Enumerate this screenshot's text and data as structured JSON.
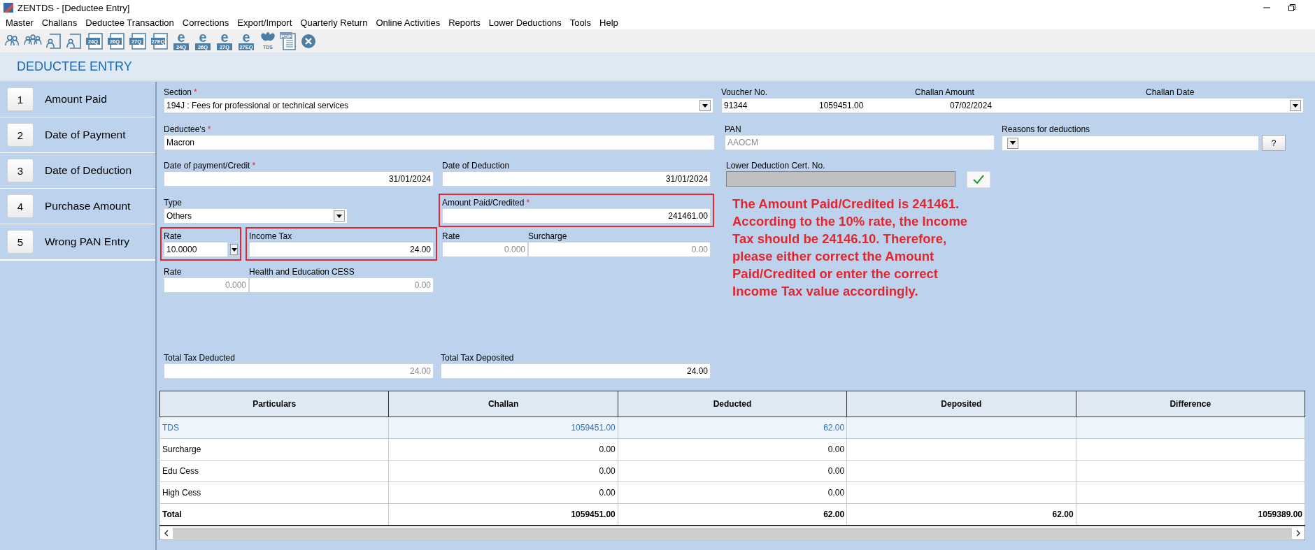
{
  "window": {
    "title": "ZENTDS - [Deductee Entry]"
  },
  "menu": [
    "Master",
    "Challans",
    "Deductee Transaction",
    "Corrections",
    "Export/Import",
    "Quarterly Return",
    "Online Activities",
    "Reports",
    "Lower Deductions",
    "Tools",
    "Help"
  ],
  "toolbar": [
    {
      "kind": "person"
    },
    {
      "kind": "group"
    },
    {
      "kind": "contact-doc"
    },
    {
      "kind": "contact-doc"
    },
    {
      "kind": "form-doc",
      "label": "24Q"
    },
    {
      "kind": "form-doc",
      "label": "26Q"
    },
    {
      "kind": "form-doc",
      "label": "27Q"
    },
    {
      "kind": "form-doc",
      "label": "27EQ"
    },
    {
      "kind": "e-form",
      "glyph": "e",
      "label": "24Q"
    },
    {
      "kind": "e-form",
      "glyph": "e",
      "label": "26Q"
    },
    {
      "kind": "e-form",
      "glyph": "e",
      "label": "27Q"
    },
    {
      "kind": "e-form",
      "glyph": "e",
      "label": "27EQ"
    },
    {
      "kind": "logo",
      "label": "TDS"
    },
    {
      "kind": "pdf",
      "label": "PDF"
    },
    {
      "kind": "close"
    }
  ],
  "header": {
    "title": "DEDUCTEE ENTRY"
  },
  "sidebar": {
    "items": [
      {
        "number": "1",
        "label": "Amount Paid"
      },
      {
        "number": "2",
        "label": "Date of Payment"
      },
      {
        "number": "3",
        "label": "Date of Deduction"
      },
      {
        "number": "4",
        "label": "Purchase Amount"
      },
      {
        "number": "5",
        "label": "Wrong PAN Entry"
      }
    ]
  },
  "form": {
    "section": {
      "label": "Section",
      "required_mark": "*",
      "value": "194J : Fees for professional or technical services"
    },
    "challan": {
      "columns": [
        "Voucher No.",
        "Challan Amount",
        "Challan Date"
      ],
      "values": [
        "91344",
        "1059451.00",
        "07/02/2024"
      ]
    },
    "deductee": {
      "label": "Deductee's",
      "required_mark": "*",
      "value": "Macron"
    },
    "pan": {
      "label": "PAN",
      "value": "AAOCM",
      "dimmed": true
    },
    "reasons": {
      "label": "Reasons for deductions",
      "help": "?"
    },
    "date_of_payment": {
      "label": "Date of payment/Credit",
      "required_mark": "*",
      "value": "31/01/2024"
    },
    "date_of_deduction": {
      "label": "Date of Deduction",
      "value": "31/01/2024"
    },
    "lower_cert": {
      "label": "Lower Deduction Cert. No.",
      "disabled": true
    },
    "type": {
      "label": "Type",
      "value": "Others"
    },
    "amount_paid": {
      "label": "Amount Paid/Credited",
      "required_mark": "*",
      "value": "241461.00",
      "highlighted": true
    },
    "rate": {
      "label": "Rate",
      "value": "10.0000",
      "highlighted": true
    },
    "income_tax": {
      "label": "Income Tax",
      "value": "24.00",
      "highlighted": true
    },
    "surcharge_rate": {
      "label": "Rate",
      "value": "0.000",
      "dimmed": true
    },
    "surcharge": {
      "label": "Surcharge",
      "value": "0.00",
      "dimmed": true
    },
    "cess_rate": {
      "label": "Rate",
      "value": "0.000",
      "dimmed": true
    },
    "cess": {
      "label": "Health and Education CESS",
      "value": "0.00",
      "dimmed": true
    },
    "total_deducted": {
      "label": "Total Tax Deducted",
      "value": "24.00",
      "dimmed": true
    },
    "total_deposited": {
      "label": "Total Tax Deposited",
      "value": "24.00"
    }
  },
  "message": "The Amount Paid/Credited is 241461. According to the 10% rate, the Income Tax should be 24146.10. Therefore, please either correct the Amount Paid/Credited or enter the correct Income Tax value accordingly.",
  "table": {
    "columns": [
      "Particulars",
      "Challan",
      "Deducted",
      "Deposited",
      "Difference"
    ],
    "rows": [
      {
        "kind": "item",
        "selected": true,
        "cells": [
          "TDS",
          "1059451.00",
          "62.00"
        ]
      },
      {
        "kind": "item",
        "selected": false,
        "cells": [
          "Surcharge",
          "0.00",
          "0.00"
        ]
      },
      {
        "kind": "item",
        "selected": false,
        "cells": [
          "Edu Cess",
          "0.00",
          "0.00"
        ]
      },
      {
        "kind": "item",
        "selected": false,
        "cells": [
          "High Cess",
          "0.00",
          "0.00"
        ]
      },
      {
        "kind": "total",
        "selected": false,
        "cells": [
          "Total",
          "1059451.00",
          "62.00",
          "62.00",
          "1059389.00"
        ]
      }
    ]
  }
}
